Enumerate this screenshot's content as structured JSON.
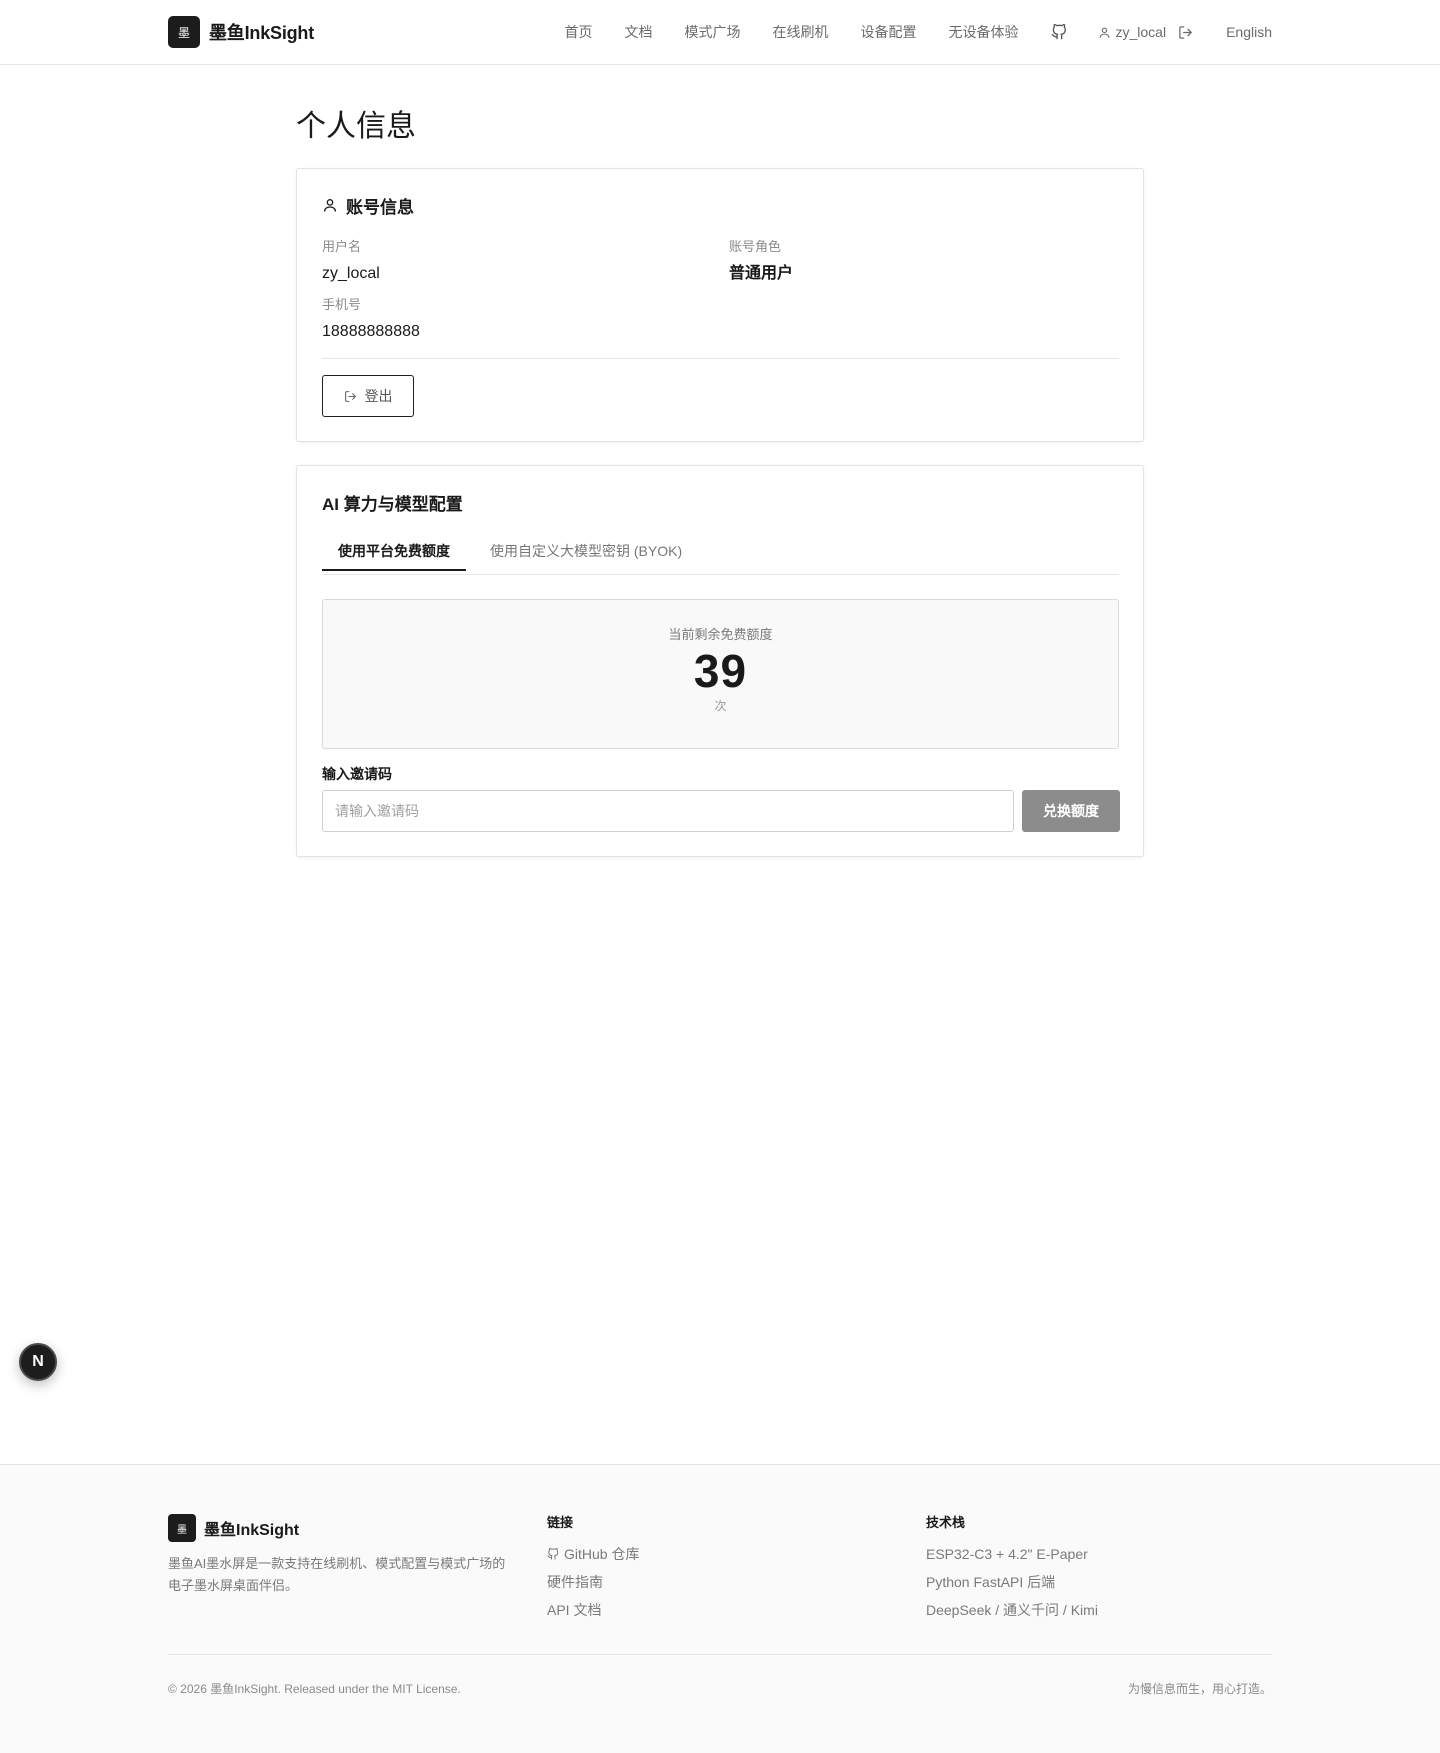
{
  "header": {
    "logo_glyph": "墨",
    "brand": "墨鱼InkSight",
    "nav": [
      "首页",
      "文档",
      "模式广场",
      "在线刷机",
      "设备配置",
      "无设备体验"
    ],
    "github_icon": "github-icon",
    "username": "zy_local",
    "language": "English"
  },
  "page": {
    "title": "个人信息"
  },
  "account": {
    "title": "账号信息",
    "username_label": "用户名",
    "username": "zy_local",
    "role_label": "账号角色",
    "role": "普通用户",
    "phone_label": "手机号",
    "phone": "18888888888",
    "logout_label": "登出"
  },
  "ai": {
    "title": "AI 算力与模型配置",
    "tabs": [
      "使用平台免费额度",
      "使用自定义大模型密钥 (BYOK)"
    ],
    "active_tab": 0,
    "quota_label": "当前剩余免费额度",
    "quota_value": "39",
    "quota_unit": "次",
    "invite_label": "输入邀请码",
    "invite_placeholder": "请输入邀请码",
    "redeem_label": "兑换额度"
  },
  "floating": {
    "label": "N"
  },
  "footer": {
    "logo_glyph": "墨",
    "brand": "墨鱼InkSight",
    "description": "墨鱼AI墨水屏是一款支持在线刷机、模式配置与模式广场的电子墨水屏桌面伴侣。",
    "links_heading": "链接",
    "links": [
      "GitHub 仓库",
      "硬件指南",
      "API 文档"
    ],
    "tech_heading": "技术栈",
    "tech": [
      "ESP32-C3 + 4.2\" E-Paper",
      "Python FastAPI 后端",
      "DeepSeek / 通义千问 / Kimi"
    ],
    "copyright": "© 2026 墨鱼InkSight. Released under the MIT License.",
    "slogan": "为慢信息而生，用心打造。"
  },
  "colors": {
    "primary": "#1a1a1a",
    "muted": "#7a7a7a",
    "redeem_button": "#8c8c8c",
    "quota_bg": "#f9f9f9"
  }
}
